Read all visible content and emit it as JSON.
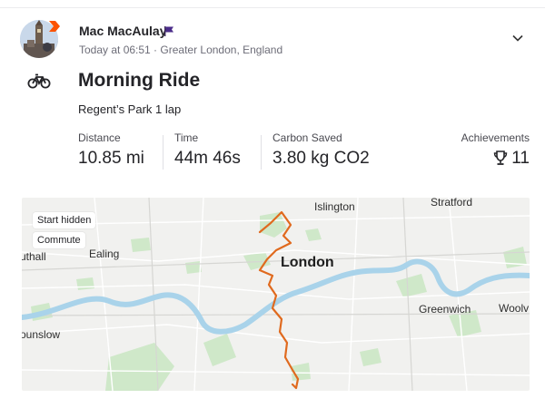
{
  "athlete": {
    "name": "Mac MacAulay",
    "timestamp": "Today at 06:51",
    "location": "Greater London, England",
    "meta": "Today at 06:51 · Greater London, England"
  },
  "activity": {
    "sport_icon": "bike-icon",
    "title": "Morning Ride",
    "description": "Regent’s Park 1 lap"
  },
  "stats": [
    {
      "label": "Distance",
      "value": "10.85 mi"
    },
    {
      "label": "Time",
      "value": "44m 46s"
    },
    {
      "label": "Carbon Saved",
      "value": "3.80 kg CO2"
    }
  ],
  "achievements": {
    "label": "Achievements",
    "count": "11",
    "icon": "trophy-icon"
  },
  "map": {
    "chips": [
      "Start hidden",
      "Commute"
    ],
    "labels": {
      "islington": "Islington",
      "stratford": "Stratford",
      "ealing": "Ealing",
      "southall": "uthall",
      "london": "London",
      "greenwich": "Greenwich",
      "woolwich": "Woolv",
      "hounslow": "ounslow"
    },
    "route_color": "#e06a1e"
  },
  "colors": {
    "accent": "#fc5200",
    "text": "#242428",
    "muted": "#6d6d78"
  }
}
